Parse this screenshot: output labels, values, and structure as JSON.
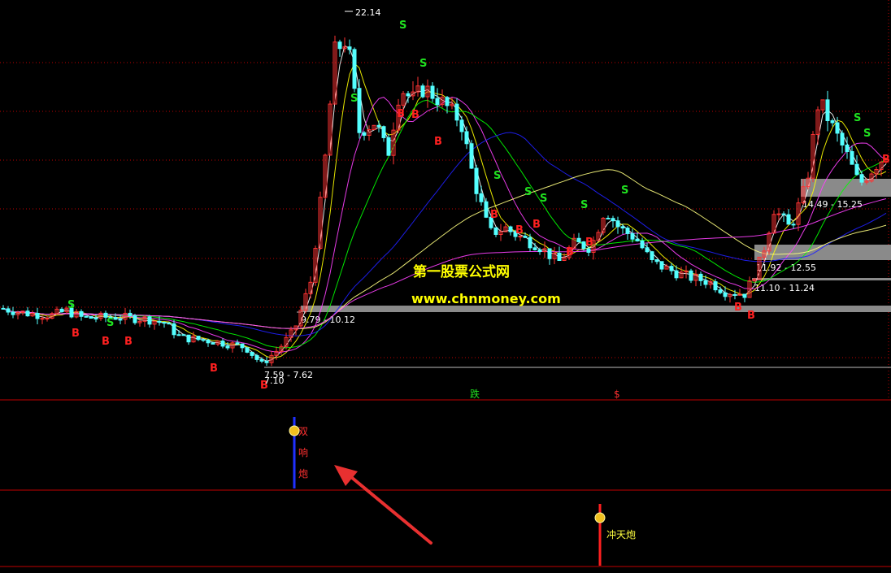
{
  "watermark": {
    "title": "第一股票公式网",
    "url": "www.chnmoney.com"
  },
  "chart_data": {
    "type": "candlestick",
    "peak_label": "22.14",
    "low_label": "7.10",
    "zones": [
      {
        "label": "7.59 - 7.62",
        "low": 7.59,
        "high": 7.62
      },
      {
        "label": "9.79 - 10.12",
        "low": 9.79,
        "high": 10.12
      },
      {
        "label": "11.10 - 11.24",
        "low": 11.1,
        "high": 11.24
      },
      {
        "label": "11.92 - 12.55",
        "low": 11.92,
        "high": 12.55
      },
      {
        "label": "14.49 - 15.25",
        "low": 14.49,
        "high": 15.25
      }
    ],
    "signals": {
      "buy_label": "B",
      "sell_label": "S"
    },
    "indicator_labels": {
      "drop": "跌",
      "dollar": "$",
      "sound_cannon": [
        "双",
        "响",
        "炮"
      ],
      "sky_cannon": "冲天炮"
    },
    "colors": {
      "background": "#000000",
      "up": "#ff3333",
      "down": "#54ffff",
      "buy": "#ff2020",
      "sell": "#20e020",
      "grid": "#c00000",
      "zone": "#8a8a8a",
      "arrow": "#e83030"
    },
    "ma_colors": [
      "#ffffff",
      "#ffff00",
      "#ff40ff",
      "#00ff00",
      "#2020ff",
      "#ffff80",
      "#ff40ff"
    ]
  }
}
